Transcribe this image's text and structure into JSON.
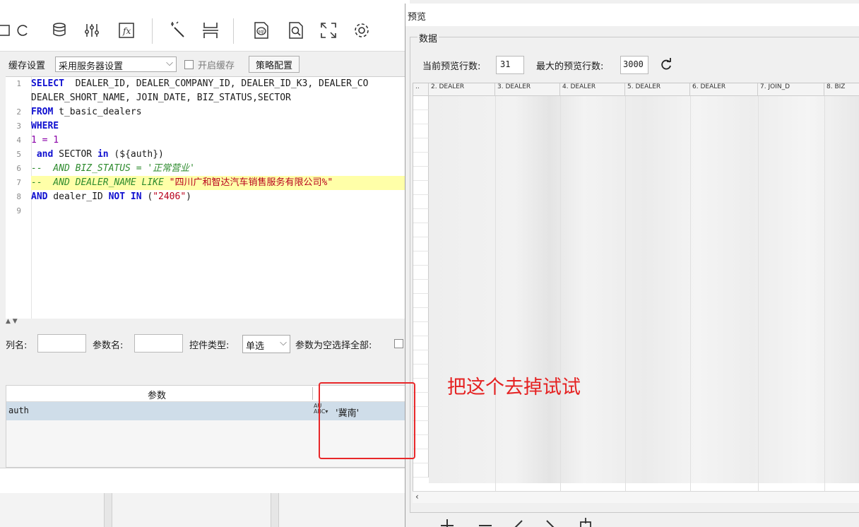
{
  "toolbar": {
    "icons": [
      "query-icon",
      "refresh-icon",
      "database-sql-icon",
      "filter-params-icon",
      "formula-icon",
      "magic-wand-icon",
      "page-break-icon",
      "sql-file-icon",
      "preview-search-icon",
      "fullscreen-icon",
      "settings-icon"
    ]
  },
  "cache": {
    "label": "缓存设置",
    "select_value": "采用服务器设置",
    "enable_label": "开启缓存",
    "strategy_button": "策略配置"
  },
  "editor": {
    "line_numbers": [
      "1",
      "2",
      "3",
      "4",
      "5",
      "6",
      "7",
      "8",
      "9"
    ],
    "lines": {
      "l1_kw": "SELECT",
      "l1_rest": "  DEALER_ID, DEALER_COMPANY_ID, DEALER_ID_K3, DEALER_CO",
      "l1b": "DEALER_SHORT_NAME, JOIN_DATE, BIZ_STATUS,SECTOR",
      "l2_kw": "FROM",
      "l2_rest": " t_basic_dealers",
      "l3_kw": "WHERE",
      "l4": "1 = 1",
      "l5_kw1": " and",
      "l5_mid": " SECTOR ",
      "l5_kw2": "in",
      "l5_rest": " (${auth})",
      "l6": "--  AND BIZ_STATUS = '正常营业'",
      "l7_cm": "--  AND DEALER_NAME LIKE ",
      "l7_str": "\"四川广和智达汽车销售服务有限公司%\"",
      "l8_kw1": "AND",
      "l8_mid": " dealer_ID ",
      "l8_kw2": "NOT IN",
      "l8_open": " (",
      "l8_str": "\"2406\"",
      "l8_close": ")"
    }
  },
  "params": {
    "column_label": "列名:",
    "param_name_label": "参数名:",
    "control_type_label": "控件类型:",
    "control_type_value": "单选",
    "empty_select_all_label": "参数为空选择全部:",
    "table_header": "参数",
    "row_name": "auth",
    "row_value": "'冀南'"
  },
  "preview": {
    "title": "预览",
    "group_label": "数据",
    "current_rows_label": "当前预览行数:",
    "current_rows_value": "31",
    "max_rows_label": "最大的预览行数:",
    "max_rows_value": "3000",
    "grid_headers": [
      "..",
      "2. DEALER",
      "3. DEALER",
      "4. DEALER",
      "5. DEALER",
      "6. DEALER",
      "7. JOIN_D",
      "8. BIZ"
    ]
  },
  "annotation": {
    "text": "把这个去掉试试",
    "color": "#e52222"
  }
}
